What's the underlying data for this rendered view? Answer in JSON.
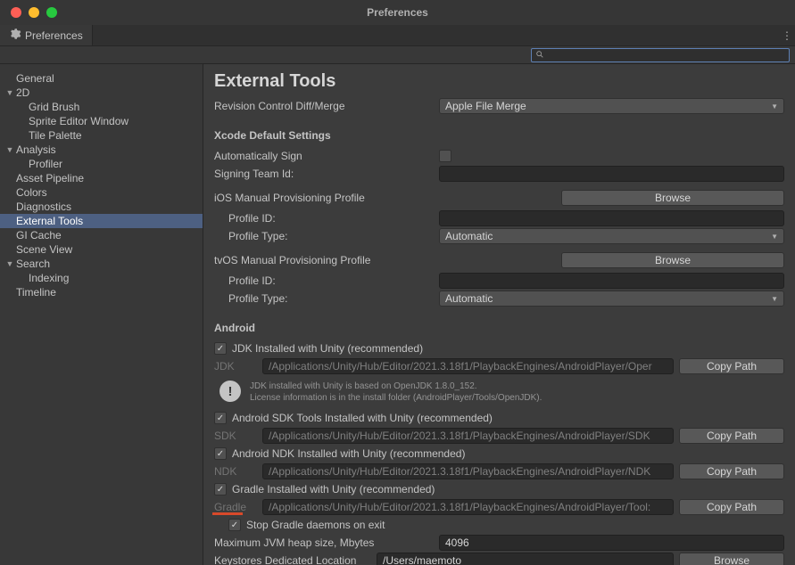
{
  "window": {
    "title": "Preferences"
  },
  "tab": {
    "label": "Preferences"
  },
  "search": {
    "placeholder": ""
  },
  "sidebar": {
    "items": [
      {
        "label": "General",
        "indent": 0,
        "expandable": false
      },
      {
        "label": "2D",
        "indent": 0,
        "expandable": true
      },
      {
        "label": "Grid Brush",
        "indent": 1,
        "expandable": false
      },
      {
        "label": "Sprite Editor Window",
        "indent": 1,
        "expandable": false
      },
      {
        "label": "Tile Palette",
        "indent": 1,
        "expandable": false
      },
      {
        "label": "Analysis",
        "indent": 0,
        "expandable": true
      },
      {
        "label": "Profiler",
        "indent": 1,
        "expandable": false
      },
      {
        "label": "Asset Pipeline",
        "indent": 0,
        "expandable": false
      },
      {
        "label": "Colors",
        "indent": 0,
        "expandable": false
      },
      {
        "label": "Diagnostics",
        "indent": 0,
        "expandable": false
      },
      {
        "label": "External Tools",
        "indent": 0,
        "expandable": false,
        "selected": true
      },
      {
        "label": "GI Cache",
        "indent": 0,
        "expandable": false
      },
      {
        "label": "Scene View",
        "indent": 0,
        "expandable": false
      },
      {
        "label": "Search",
        "indent": 0,
        "expandable": true
      },
      {
        "label": "Indexing",
        "indent": 1,
        "expandable": false
      },
      {
        "label": "Timeline",
        "indent": 0,
        "expandable": false
      }
    ]
  },
  "content": {
    "title": "External Tools",
    "revision_label": "Revision Control Diff/Merge",
    "revision_value": "Apple File Merge",
    "xcode_header": "Xcode Default Settings",
    "auto_sign_label": "Automatically Sign",
    "signing_team_label": "Signing Team Id:",
    "signing_team_value": "",
    "ios_header": "iOS Manual Provisioning Profile",
    "tvos_header": "tvOS Manual Provisioning Profile",
    "profile_id_label": "Profile ID:",
    "profile_type_label": "Profile Type:",
    "profile_type_value": "Automatic",
    "browse_label": "Browse",
    "copy_path_label": "Copy Path",
    "android_header": "Android",
    "jdk_check_label": "JDK Installed with Unity (recommended)",
    "jdk_label": "JDK",
    "jdk_path": "/Applications/Unity/Hub/Editor/2021.3.18f1/PlaybackEngines/AndroidPlayer/Oper",
    "jdk_info_line1": "JDK installed with Unity is based on OpenJDK 1.8.0_152.",
    "jdk_info_line2": "License information is in the install folder (AndroidPlayer/Tools/OpenJDK).",
    "sdk_check_label": "Android SDK Tools Installed with Unity (recommended)",
    "sdk_label": "SDK",
    "sdk_path": "/Applications/Unity/Hub/Editor/2021.3.18f1/PlaybackEngines/AndroidPlayer/SDK",
    "ndk_check_label": "Android NDK Installed with Unity (recommended)",
    "ndk_label": "NDK",
    "ndk_path": "/Applications/Unity/Hub/Editor/2021.3.18f1/PlaybackEngines/AndroidPlayer/NDK",
    "gradle_check_label": "Gradle Installed with Unity (recommended)",
    "gradle_label": "Gradle",
    "gradle_path": "/Applications/Unity/Hub/Editor/2021.3.18f1/PlaybackEngines/AndroidPlayer/Tool:",
    "stop_daemons_label": "Stop Gradle daemons on exit",
    "jvm_heap_label": "Maximum JVM heap size, Mbytes",
    "jvm_heap_value": "4096",
    "keystores_label": "Keystores Dedicated Location",
    "keystores_value": "/Users/maemoto"
  }
}
